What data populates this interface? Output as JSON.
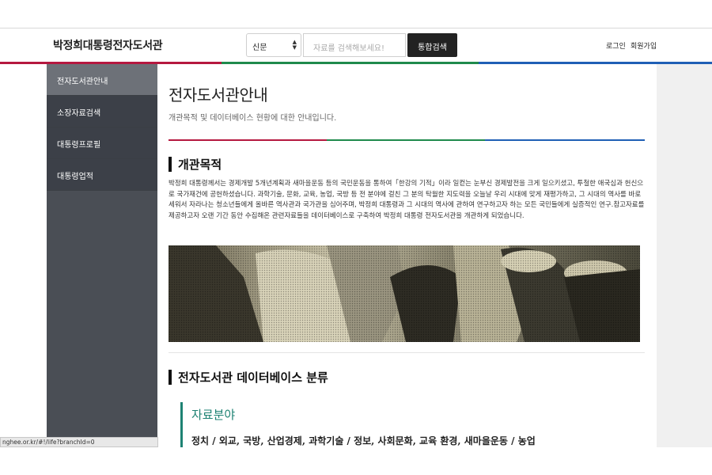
{
  "header": {
    "site_title": "박정희대통령전자도서관",
    "search_select": "신문",
    "search_placeholder": "자료를 검색해보세요!",
    "search_button": "통합검색",
    "login": "로그인",
    "signup": "회원가입",
    "colors": [
      "#b5183f",
      "#1f8a4c",
      "#1f5fb5"
    ]
  },
  "sidebar": {
    "items": [
      {
        "label": "전자도서관안내",
        "active": true
      },
      {
        "label": "소장자료검색",
        "active": false
      },
      {
        "label": "대통령프로필",
        "active": false
      },
      {
        "label": "대통령업적",
        "active": false
      }
    ]
  },
  "main": {
    "title": "전자도서관안내",
    "subtitle": "개관목적 및 데이터베이스 현황에 대한 안내입니다.",
    "section1": {
      "heading": "개관목적",
      "text": "박정희 대통령께서는 경제개발 5개년계획과 새마을운동 등의 국민운동을 통하여「한강의 기적」이라 일컫는 눈부신 경제발전을 크게 일으키셨고, 투철한 애국심과 헌신으로 국가재건에 공헌하셨습니다. 과학기술, 문화, 교육, 농업, 국방 등 전 분야에 걸친 그 분의 탁월한 지도력을 오늘날 우리 시대에 맞게 재평가하고, 그 시대의 역사를 바로 세워서 자라나는 청소년들에게 올바른 역사관과 국가관을 심어주며, 박정희 대통령과 그 시대의 역사에 관하여 연구하고자 하는 모든 국민들에게 실증적인 연구.참고자료를 제공하고자 오랜 기간 동안 수집해온 관련자료들을 데이터베이스로 구축하여 박정희 대통령 전자도서관을 개관하게 되었습니다."
    },
    "section2": {
      "heading": "전자도서관 데이터베이스 분류",
      "category_title": "자료분야",
      "category_list": "정치 / 외교, 국방, 산업경제, 과학기술 / 정보, 사회문화, 교육 환경, 새마을운동 / 농업"
    }
  },
  "status_url": "nghee.or.kr/#!/life?branchId=0"
}
